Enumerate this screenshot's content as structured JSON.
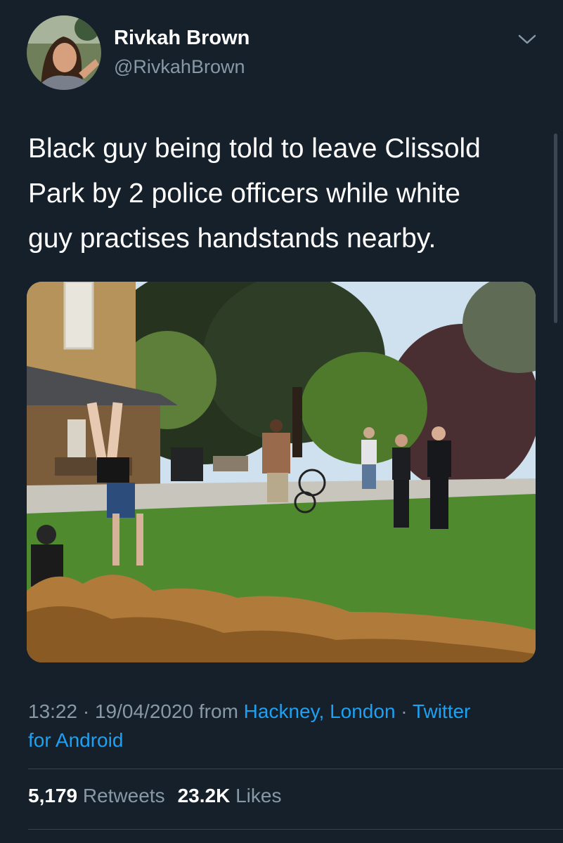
{
  "author": {
    "display_name": "Rivkah Brown",
    "handle": "@RivkahBrown"
  },
  "tweet": {
    "text_lines": [
      "Black guy being told to leave Clissold",
      "Park by 2 police officers while white",
      "guy practises handstands nearby."
    ]
  },
  "meta": {
    "time": "13:22",
    "separator": " · ",
    "date": "19/04/2020",
    "from_label": " from ",
    "location": "Hackney, London",
    "source_part1": "Twitter",
    "source_part2": "for Android"
  },
  "stats": {
    "retweets_count": "5,179",
    "retweets_label": "Retweets",
    "likes_count": "23.2K",
    "likes_label": "Likes"
  },
  "icons": {
    "more": "chevron-down-icon"
  },
  "colors": {
    "background": "#15202b",
    "text": "#ffffff",
    "secondary": "#8899a6",
    "link": "#1da1f2",
    "divider": "#38444d"
  }
}
